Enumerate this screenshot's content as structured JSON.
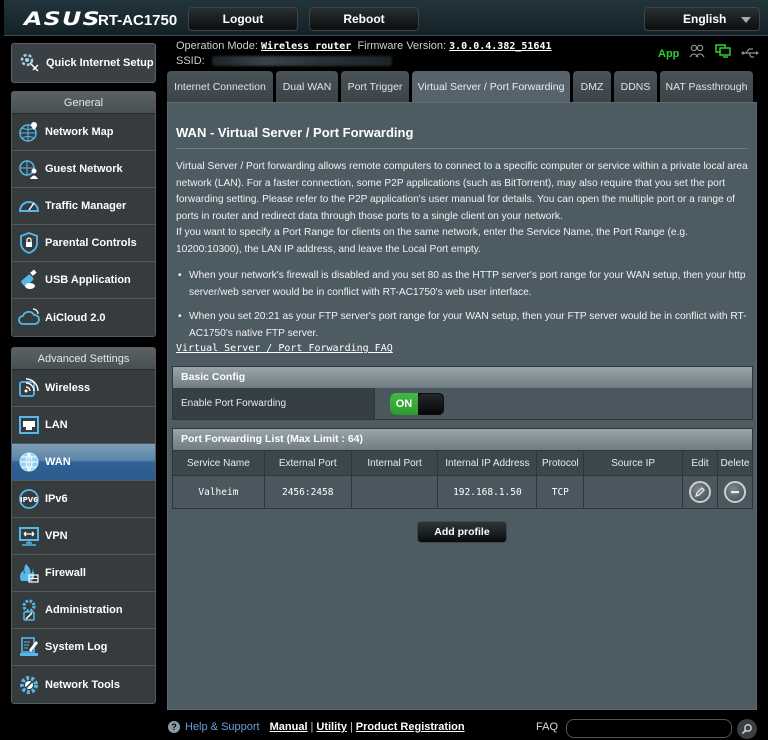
{
  "header": {
    "brand": "ASUS",
    "model": "RT-AC1750",
    "logout_label": "Logout",
    "reboot_label": "Reboot",
    "language": "English"
  },
  "status": {
    "operation_mode_label": "Operation Mode:",
    "operation_mode_value": "Wireless router",
    "firmware_label": "Firmware Version:",
    "firmware_value": "3.0.0.4.382_51641",
    "ssid_label": "SSID:",
    "app_label": "App",
    "icons": [
      "clients-icon",
      "network-status-icon",
      "usb-icon"
    ]
  },
  "sidebar": {
    "quick_setup": "Quick Internet Setup",
    "general_header": "General",
    "general_items": [
      {
        "label": "Network Map",
        "icon": "network-map-icon"
      },
      {
        "label": "Guest Network",
        "icon": "guest-network-icon"
      },
      {
        "label": "Traffic Manager",
        "icon": "traffic-manager-icon"
      },
      {
        "label": "Parental Controls",
        "icon": "parental-controls-icon"
      },
      {
        "label": "USB Application",
        "icon": "usb-application-icon"
      },
      {
        "label": "AiCloud 2.0",
        "icon": "aicloud-icon"
      }
    ],
    "advanced_header": "Advanced Settings",
    "advanced_items": [
      {
        "label": "Wireless",
        "icon": "wireless-icon"
      },
      {
        "label": "LAN",
        "icon": "lan-icon"
      },
      {
        "label": "WAN",
        "icon": "wan-icon",
        "active": true
      },
      {
        "label": "IPv6",
        "icon": "ipv6-icon"
      },
      {
        "label": "VPN",
        "icon": "vpn-icon"
      },
      {
        "label": "Firewall",
        "icon": "firewall-icon"
      },
      {
        "label": "Administration",
        "icon": "administration-icon"
      },
      {
        "label": "System Log",
        "icon": "system-log-icon"
      },
      {
        "label": "Network Tools",
        "icon": "network-tools-icon"
      }
    ]
  },
  "tabs": [
    {
      "label": "Internet Connection"
    },
    {
      "label": "Dual WAN"
    },
    {
      "label": "Port Trigger"
    },
    {
      "label": "Virtual Server / Port Forwarding",
      "active": true
    },
    {
      "label": "DMZ"
    },
    {
      "label": "DDNS"
    },
    {
      "label": "NAT Passthrough"
    }
  ],
  "main": {
    "title": "WAN - Virtual Server / Port Forwarding",
    "description_1": "Virtual Server / Port forwarding allows remote computers to connect to a specific computer or service within a private local area network (LAN). For a faster connection, some P2P applications (such as BitTorrent), may also require that you set the port forwarding setting. Please refer to the P2P application's user manual for details. You can open the multiple port or a range of ports in router and redirect data through those ports to a single client on your network.",
    "description_2": "If you want to specify a Port Range for clients on the same network, enter the Service Name, the Port Range (e.g. 10200:10300), the LAN IP address, and leave the Local Port empty.",
    "bullets": [
      "When your network's firewall is disabled and you set 80 as the HTTP server's port range for your WAN setup, then your http server/web server would be in conflict with RT-AC1750's web user interface.",
      "When you set 20:21 as your FTP server's port range for your WAN setup, then your FTP server would be in conflict with RT-AC1750's native FTP server."
    ],
    "faq_link": "Virtual Server / Port Forwarding FAQ",
    "basic_config": {
      "header": "Basic Config",
      "enable_label": "Enable Port Forwarding",
      "enable_value": "ON"
    },
    "pf_list": {
      "header": "Port Forwarding List (Max Limit : 64)",
      "columns": [
        "Service Name",
        "External Port",
        "Internal Port",
        "Internal IP Address",
        "Protocol",
        "Source IP",
        "Edit",
        "Delete"
      ],
      "rows": [
        {
          "service": "Valheim",
          "external_port": "2456:2458",
          "internal_port": "",
          "internal_ip": "192.168.1.50",
          "protocol": "TCP",
          "source_ip": ""
        }
      ]
    },
    "add_profile": "Add profile"
  },
  "footer": {
    "help": "Help & Support",
    "links": [
      "Manual",
      "Utility",
      "Product Registration"
    ],
    "faq_label": "FAQ",
    "faq_input_value": ""
  },
  "colors": {
    "accent_green": "#33cc33",
    "active_blue": "#2f6296",
    "panel_bg": "#4d5b62"
  }
}
